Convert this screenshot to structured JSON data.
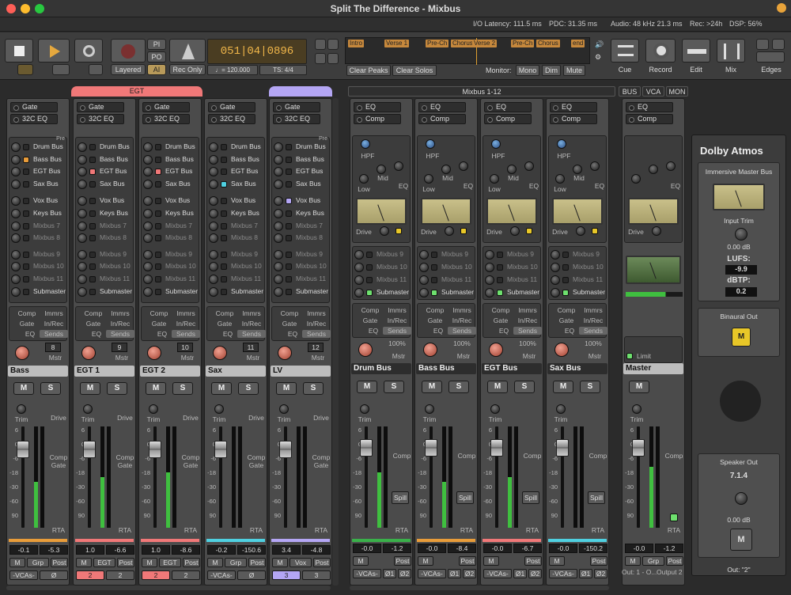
{
  "window": {
    "title": "Split The Difference - Mixbus"
  },
  "status": {
    "io_latency": "I/O Latency: 111.5 ms",
    "pdc": "PDC: 31.35 ms",
    "audio": "Audio: 48 kHz 21.3 ms",
    "rec": "Rec: >24h",
    "dsp": "DSP: 56%"
  },
  "transport": {
    "pi": "PI",
    "po": "PO",
    "ai": "AI",
    "layered": "Layered",
    "rec_only": "Rec Only",
    "clock": "051|04|0896",
    "tempo": "♩= 120.000",
    "ts": "TS: 4/4"
  },
  "markers": [
    "Intro",
    "Verse 1",
    "Pre-Ch",
    "Chorus",
    "Verse 2",
    "Pre-Ch",
    "Chorus",
    "end"
  ],
  "panel_buttons": {
    "clear_peaks": "Clear Peaks",
    "clear_solos": "Clear Solos",
    "monitor": "Monitor:",
    "mono": "Mono",
    "dim": "Dim",
    "mute": "Mute"
  },
  "pages": {
    "cue": "Cue",
    "record": "Record",
    "edit": "Edit",
    "mix": "Mix",
    "edges": "Edges"
  },
  "groups": {
    "egt": "EGT",
    "mixbus_header": "Mixbus 1-12",
    "bus": "BUS",
    "vca": "VCA",
    "mon": "MON"
  },
  "sends": [
    "Drum Bus",
    "Bass Bus",
    "EGT Bus",
    "Sax Bus",
    "Vox Bus",
    "Keys Bus",
    "Mixbus 7",
    "Mixbus 8",
    "Mixbus 9",
    "Mixbus 10",
    "Mixbus 11",
    "Submaster"
  ],
  "mixbus_sends": [
    "Mixbus 9",
    "Mixbus 10",
    "Mixbus 11",
    "Submaster"
  ],
  "tracks": [
    {
      "name": "Bass",
      "num": "8",
      "plugins": [
        "Gate",
        "32C EQ"
      ],
      "gain": "-0.1",
      "peak": "-5.3",
      "grp": "Grp",
      "num2": "Ø",
      "color": "#e89c3a",
      "level": 0.45,
      "pre": "Pre"
    },
    {
      "name": "EGT 1",
      "num": "9",
      "plugins": [
        "Gate",
        "32C EQ"
      ],
      "gain": "1.0",
      "peak": "-6.6",
      "grp": "EGT",
      "num2": "2",
      "color": "#f07878",
      "level": 0.5,
      "pre": ""
    },
    {
      "name": "EGT 2",
      "num": "10",
      "plugins": [
        "Gate",
        "32C EQ"
      ],
      "gain": "1.0",
      "peak": "-8.6",
      "grp": "EGT",
      "num2": "2",
      "color": "#f07878",
      "level": 0.55,
      "pre": ""
    },
    {
      "name": "Sax",
      "num": "11",
      "plugins": [
        "Gate",
        "32C EQ"
      ],
      "gain": "-0.2",
      "peak": "-150.6",
      "grp": "Grp",
      "num2": "Ø",
      "color": "#4fd0e0",
      "level": 0.0,
      "pre": ""
    },
    {
      "name": "LV",
      "num": "12",
      "plugins": [
        "Gate",
        "32C EQ"
      ],
      "gain": "3.4",
      "peak": "-4.8",
      "grp": "Vox",
      "num2": "3",
      "color": "#b4a6f4",
      "level": 0.0,
      "pre": "Pre"
    }
  ],
  "strip_proc": {
    "comp": "Comp",
    "immrs": "Immrs",
    "gate": "Gate",
    "inrec": "In/Rec",
    "eq": "EQ",
    "sends": "Sends",
    "mstr": "Mstr",
    "trim": "Trim",
    "drive": "Drive",
    "comp2": "Comp",
    "gate2": "Gate",
    "rta": "RTA",
    "m": "M",
    "s": "S",
    "post": "Post",
    "vcas": "-VCAs-"
  },
  "buses": [
    {
      "name": "Drum Bus",
      "gain": "-0.0",
      "peak": "-1.2",
      "color": "#3ab04a",
      "level": 0.55
    },
    {
      "name": "Bass Bus",
      "gain": "-0.0",
      "peak": "-8.4",
      "color": "#e89c3a",
      "level": 0.45
    },
    {
      "name": "EGT Bus",
      "gain": "-0.0",
      "peak": "-6.7",
      "color": "#f07878",
      "level": 0.5
    },
    {
      "name": "Sax Bus",
      "gain": "-0.0",
      "peak": "-150.2",
      "color": "#4fd0e0",
      "level": 0.0
    }
  ],
  "bus_proc": {
    "eq": "EQ",
    "comp": "Comp",
    "hpf": "HPF",
    "low": "Low",
    "mid": "Mid",
    "hi": "Hi",
    "drive": "Drive",
    "percent": "100%",
    "spill": "Spill",
    "phase1": "Ø1",
    "phase2": "Ø2"
  },
  "master": {
    "name": "Master",
    "gain": "-0.0",
    "peak": "-1.2",
    "limit": "Limit",
    "out1": "Out: 1 - O...",
    "out2": "Output 2",
    "level": 0.6
  },
  "atmos": {
    "logo": "Dolby Atmos",
    "bus": "Immersive Master Bus",
    "input_trim": "Input Trim",
    "trim_db": "0.00 dB",
    "lufs_label": "LUFS:",
    "lufs": "-9.9",
    "dbtp_label": "dBTP:",
    "dbtp": "0.2",
    "binaural": "Binaural Out",
    "m": "M",
    "speaker_out": "Speaker Out",
    "format": "7.1.4",
    "speaker_db": "0.00 dB",
    "out": "Out: \"2\""
  },
  "scale": [
    "-20",
    "6",
    "3",
    "0",
    "-3",
    "-6",
    "-12",
    "-18",
    "-24",
    "-30",
    "-40",
    "-50",
    "-60",
    "90"
  ]
}
